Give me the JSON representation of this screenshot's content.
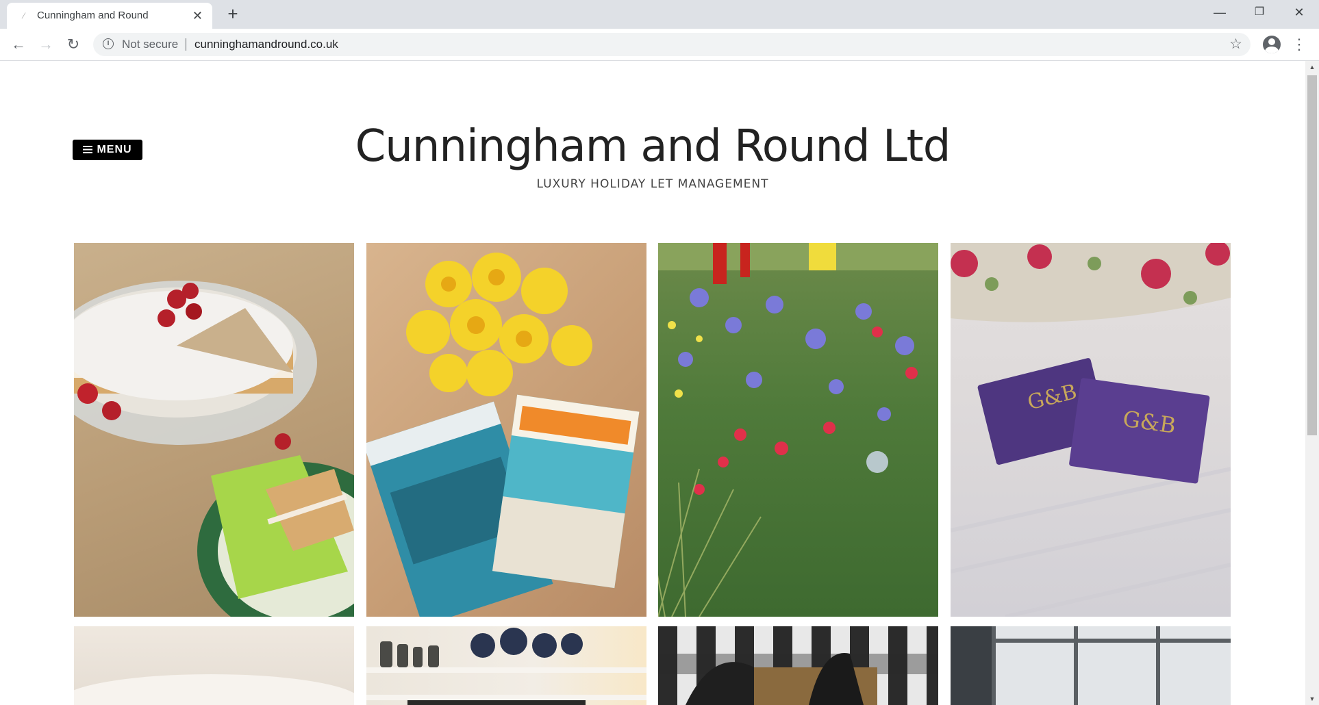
{
  "browser": {
    "tab_title": "Cunningham and Round",
    "new_tab_symbol": "+",
    "close_symbol": "✕",
    "security_label": "Not secure",
    "url": "cunninghamandround.co.uk",
    "controls": {
      "minimize": "—",
      "restore": "❐",
      "close": "✕"
    },
    "icons": [
      "back-arrow-icon",
      "forward-arrow-icon",
      "reload-icon",
      "info-icon",
      "star-icon",
      "profile-icon",
      "kebab-menu-icon"
    ]
  },
  "site": {
    "menu_label": "MENU",
    "title": "Cunningham and Round Ltd",
    "tagline": "LUXURY HOLIDAY LET MANAGEMENT"
  },
  "gallery": {
    "row1": [
      {
        "name": "victoria-sponge-cake-photo"
      },
      {
        "name": "daffodils-and-magazines-photo"
      },
      {
        "name": "flower-garden-photo"
      },
      {
        "name": "salted-caramel-chocolates-photo"
      }
    ],
    "row2": [
      {
        "name": "white-towel-photo"
      },
      {
        "name": "dresser-shelf-ceramics-photo"
      },
      {
        "name": "picnic-basket-photo"
      },
      {
        "name": "window-view-photo"
      }
    ]
  },
  "colors": {
    "menu_bg": "#000000",
    "title": "#222222",
    "chrome_top": "#dee1e6"
  }
}
